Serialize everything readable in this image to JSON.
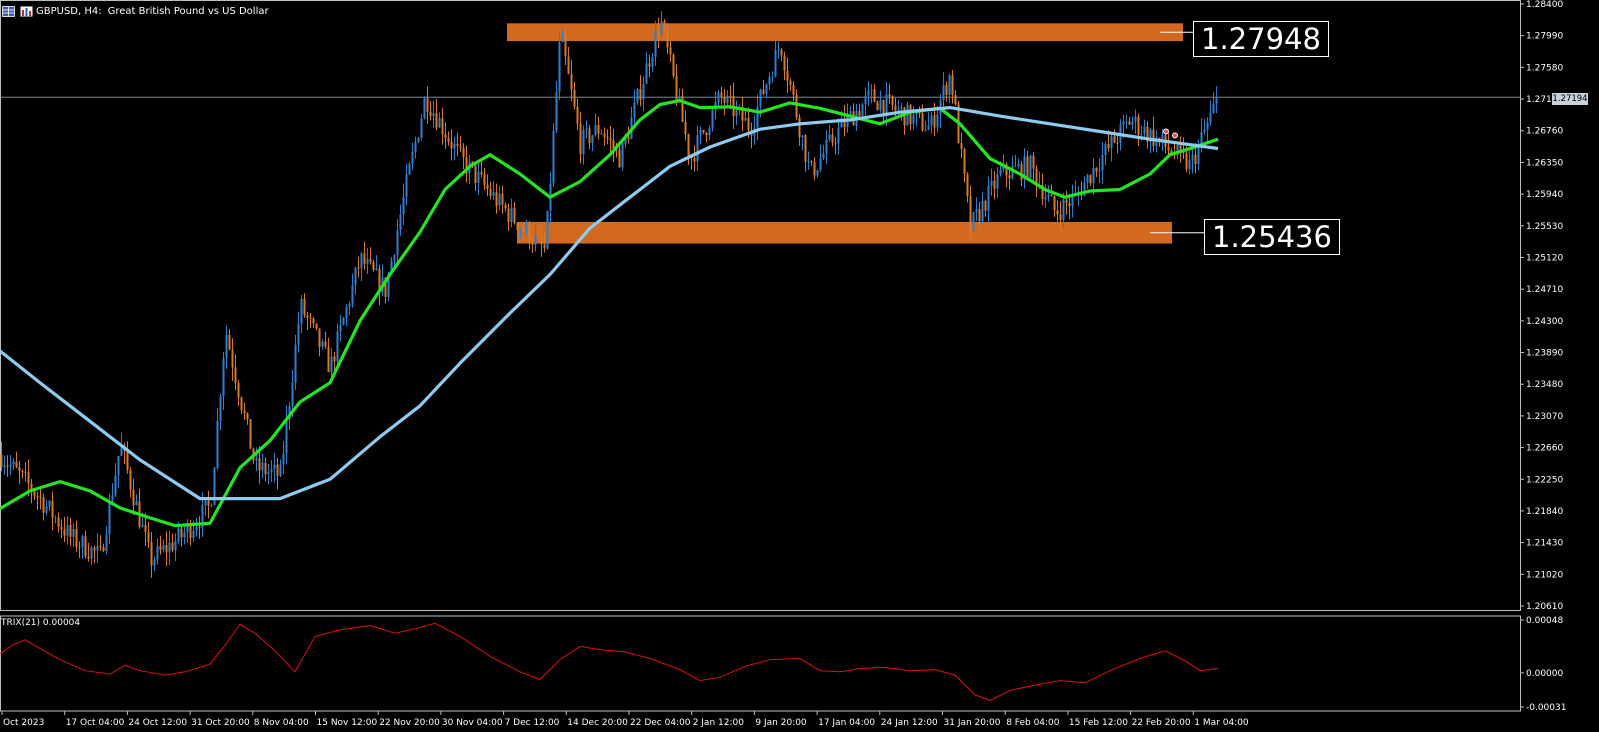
{
  "header": {
    "symbol": "GBPUSD, H4:",
    "description": "Great British Pound vs US Dollar",
    "icons": [
      "grid-menu-icon",
      "bar-chart-icon"
    ]
  },
  "current_price_tag": "1.27194",
  "level_labels": {
    "resistance": "1.27948",
    "support": "1.25436"
  },
  "chart_data": [
    {
      "type": "candlestick",
      "title": "",
      "y_axis": {
        "ticks": [
          "1.28400",
          "1.27990",
          "1.27580",
          "1.27170",
          "1.26760",
          "1.26350",
          "1.25940",
          "1.25530",
          "1.25120",
          "1.24710",
          "1.24300",
          "1.23890",
          "1.23480",
          "1.23070",
          "1.22660",
          "1.22250",
          "1.21840",
          "1.21430",
          "1.21020",
          "1.20610"
        ],
        "ylim": [
          1.2061,
          1.284
        ]
      },
      "x_axis": {
        "ticks": [
          "Oct 2023",
          "17 Oct 04:00",
          "24 Oct 12:00",
          "31 Oct 20:00",
          "8 Nov 04:00",
          "15 Nov 12:00",
          "22 Nov 20:00",
          "30 Nov 04:00",
          "7 Dec 12:00",
          "14 Dec 20:00",
          "22 Dec 04:00",
          "2 Jan 12:00",
          "9 Jan 20:00",
          "17 Jan 04:00",
          "24 Jan 12:00",
          "31 Jan 20:00",
          "8 Feb 04:00",
          "15 Feb 12:00",
          "22 Feb 20:00",
          "1 Mar 04:00"
        ]
      },
      "price_path": [
        [
          0,
          1.2257
        ],
        [
          40,
          1.22
        ],
        [
          70,
          1.215
        ],
        [
          100,
          1.2125
        ],
        [
          120,
          1.227
        ],
        [
          150,
          1.212
        ],
        [
          180,
          1.215
        ],
        [
          210,
          1.219
        ],
        [
          225,
          1.242
        ],
        [
          255,
          1.224
        ],
        [
          280,
          1.223
        ],
        [
          300,
          1.245
        ],
        [
          330,
          1.237
        ],
        [
          360,
          1.251
        ],
        [
          385,
          1.247
        ],
        [
          405,
          1.26
        ],
        [
          425,
          1.272
        ],
        [
          460,
          1.264
        ],
        [
          500,
          1.258
        ],
        [
          545,
          1.252
        ],
        [
          560,
          1.28
        ],
        [
          580,
          1.266
        ],
        [
          600,
          1.268
        ],
        [
          620,
          1.264
        ],
        [
          640,
          1.273
        ],
        [
          660,
          1.282
        ],
        [
          690,
          1.264
        ],
        [
          720,
          1.272
        ],
        [
          750,
          1.268
        ],
        [
          780,
          1.279
        ],
        [
          810,
          1.262
        ],
        [
          840,
          1.268
        ],
        [
          870,
          1.272
        ],
        [
          900,
          1.27
        ],
        [
          930,
          1.268
        ],
        [
          950,
          1.275
        ],
        [
          970,
          1.255
        ],
        [
          1000,
          1.262
        ],
        [
          1030,
          1.263
        ],
        [
          1055,
          1.257
        ],
        [
          1075,
          1.259
        ],
        [
          1100,
          1.264
        ],
        [
          1130,
          1.269
        ],
        [
          1160,
          1.266
        ],
        [
          1190,
          1.263
        ],
        [
          1218,
          1.2719
        ]
      ],
      "moving_averages": [
        {
          "color": "#23e623",
          "points": [
            [
              0,
              1.2187
            ],
            [
              30,
              1.221
            ],
            [
              60,
              1.2222
            ],
            [
              90,
              1.221
            ],
            [
              120,
              1.2188
            ],
            [
              150,
              1.2175
            ],
            [
              175,
              1.2165
            ],
            [
              210,
              1.2168
            ],
            [
              240,
              1.224
            ],
            [
              270,
              1.2275
            ],
            [
              300,
              1.2325
            ],
            [
              330,
              1.235
            ],
            [
              360,
              1.243
            ],
            [
              390,
              1.249
            ],
            [
              420,
              1.2545
            ],
            [
              445,
              1.26
            ],
            [
              470,
              1.263
            ],
            [
              490,
              1.2645
            ],
            [
              520,
              1.262
            ],
            [
              550,
              1.259
            ],
            [
              580,
              1.261
            ],
            [
              610,
              1.2645
            ],
            [
              640,
              1.269
            ],
            [
              660,
              1.271
            ],
            [
              680,
              1.2715
            ],
            [
              700,
              1.2706
            ],
            [
              730,
              1.2707
            ],
            [
              760,
              1.27
            ],
            [
              790,
              1.2712
            ],
            [
              820,
              1.2705
            ],
            [
              850,
              1.2695
            ],
            [
              880,
              1.2685
            ],
            [
              910,
              1.27
            ],
            [
              940,
              1.2705
            ],
            [
              960,
              1.2685
            ],
            [
              990,
              1.264
            ],
            [
              1020,
              1.262
            ],
            [
              1045,
              1.26
            ],
            [
              1065,
              1.259
            ],
            [
              1090,
              1.2598
            ],
            [
              1120,
              1.26
            ],
            [
              1150,
              1.262
            ],
            [
              1170,
              1.2645
            ],
            [
              1195,
              1.2655
            ],
            [
              1218,
              1.2665
            ]
          ]
        },
        {
          "color": "#8ecbf0",
          "points": [
            [
              0,
              1.2391
            ],
            [
              40,
              1.235
            ],
            [
              90,
              1.23
            ],
            [
              140,
              1.225
            ],
            [
              200,
              1.22
            ],
            [
              280,
              1.22
            ],
            [
              330,
              1.2225
            ],
            [
              380,
              1.228
            ],
            [
              420,
              1.232
            ],
            [
              460,
              1.2375
            ],
            [
              510,
              1.244
            ],
            [
              550,
              1.249
            ],
            [
              590,
              1.255
            ],
            [
              630,
              1.259
            ],
            [
              670,
              1.263
            ],
            [
              710,
              1.2655
            ],
            [
              760,
              1.2678
            ],
            [
              800,
              1.2685
            ],
            [
              850,
              1.269
            ],
            [
              900,
              1.27
            ],
            [
              950,
              1.2706
            ],
            [
              1000,
              1.2695
            ],
            [
              1050,
              1.2685
            ],
            [
              1100,
              1.2675
            ],
            [
              1150,
              1.2665
            ],
            [
              1218,
              1.2653
            ]
          ]
        }
      ],
      "zones": [
        {
          "y_top": 1.2815,
          "y_bottom": 1.2792,
          "x_start": 507,
          "x_end": 1183,
          "color": "#d2691e"
        },
        {
          "y_top": 1.2558,
          "y_bottom": 1.253,
          "x_start": 517,
          "x_end": 1172,
          "color": "#d2691e"
        }
      ],
      "current_price": 1.27194,
      "colors": {
        "bull": "#2f7fcf",
        "bear": "#d87a28",
        "price_line": "#8f9aa8"
      }
    },
    {
      "type": "line",
      "title": "TRIX(21) 0.00004",
      "y_axis": {
        "ticks": [
          "0.00048",
          "0.00000",
          "-0.00031"
        ],
        "ylim": [
          -0.00031,
          0.00048
        ]
      },
      "series": [
        {
          "color": "#e01010",
          "points": [
            [
              0,
              0.00017
            ],
            [
              12,
              0.00025
            ],
            [
              25,
              0.0003
            ],
            [
              40,
              0.00022
            ],
            [
              60,
              0.00012
            ],
            [
              85,
              2e-05
            ],
            [
              110,
              -1e-05
            ],
            [
              125,
              7e-05
            ],
            [
              140,
              2e-05
            ],
            [
              165,
              -2e-05
            ],
            [
              185,
              1e-05
            ],
            [
              210,
              8e-05
            ],
            [
              225,
              0.00025
            ],
            [
              240,
              0.00044
            ],
            [
              255,
              0.00036
            ],
            [
              275,
              0.0002
            ],
            [
              295,
              1e-05
            ],
            [
              315,
              0.00033
            ],
            [
              340,
              0.00039
            ],
            [
              370,
              0.00043
            ],
            [
              395,
              0.00036
            ],
            [
              415,
              0.0004
            ],
            [
              435,
              0.00045
            ],
            [
              460,
              0.00033
            ],
            [
              490,
              0.00015
            ],
            [
              520,
              1e-05
            ],
            [
              540,
              -6e-05
            ],
            [
              560,
              0.00012
            ],
            [
              580,
              0.00024
            ],
            [
              600,
              0.00021
            ],
            [
              625,
              0.00019
            ],
            [
              650,
              0.00013
            ],
            [
              680,
              3e-05
            ],
            [
              700,
              -7e-05
            ],
            [
              720,
              -4e-05
            ],
            [
              745,
              6e-05
            ],
            [
              770,
              0.00012
            ],
            [
              800,
              0.00013
            ],
            [
              820,
              2e-05
            ],
            [
              840,
              1e-05
            ],
            [
              860,
              4e-05
            ],
            [
              885,
              5e-05
            ],
            [
              910,
              2e-05
            ],
            [
              935,
              3e-05
            ],
            [
              955,
              -2e-05
            ],
            [
              975,
              -0.0002
            ],
            [
              990,
              -0.00025
            ],
            [
              1010,
              -0.00016
            ],
            [
              1035,
              -0.00011
            ],
            [
              1060,
              -7e-05
            ],
            [
              1085,
              -9e-05
            ],
            [
              1110,
              2e-05
            ],
            [
              1140,
              0.00013
            ],
            [
              1165,
              0.0002
            ],
            [
              1185,
              0.00011
            ],
            [
              1200,
              2e-05
            ],
            [
              1218,
              4e-05
            ]
          ]
        }
      ]
    }
  ]
}
